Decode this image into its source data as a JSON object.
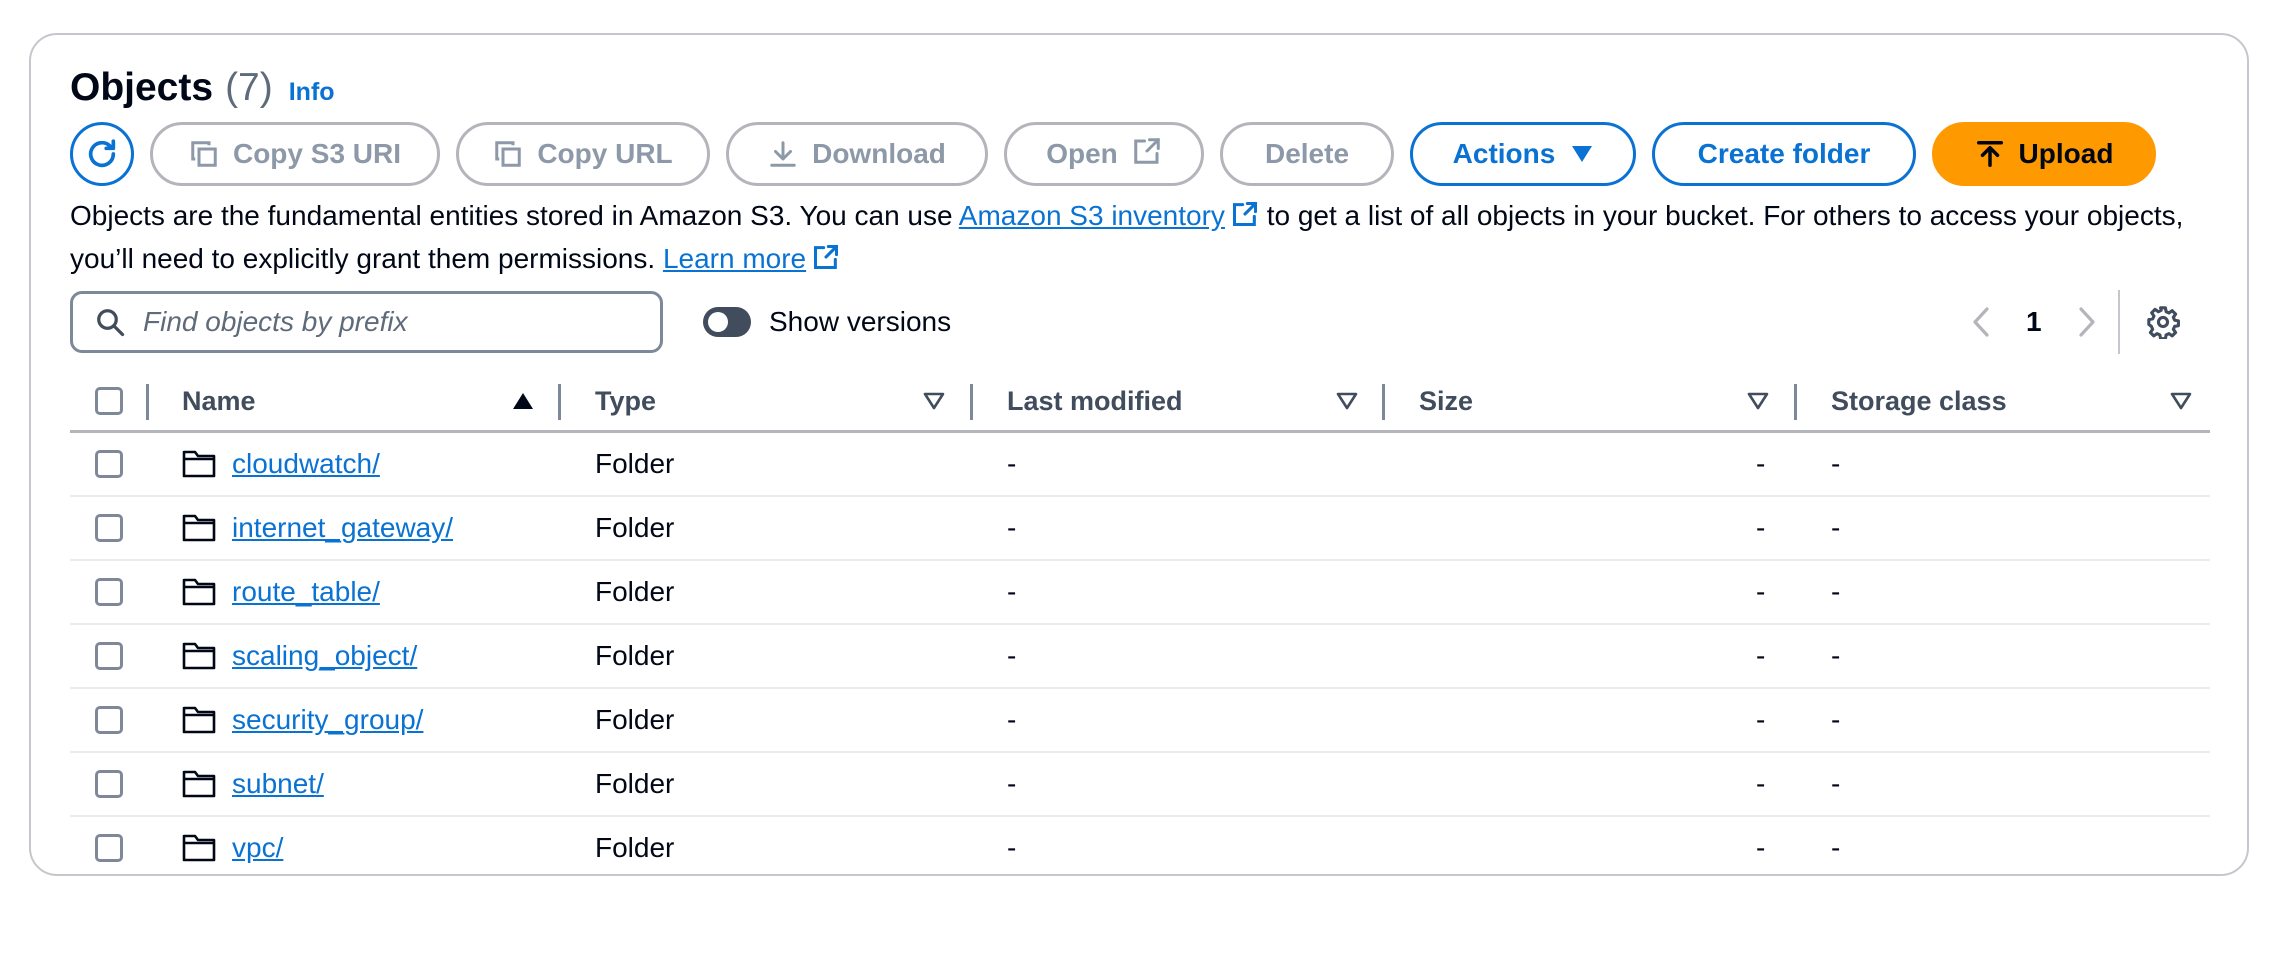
{
  "header": {
    "title": "Objects",
    "count": "(7)",
    "info": "Info"
  },
  "toolbar": {
    "copy_s3_uri": "Copy S3 URI",
    "copy_url": "Copy URL",
    "download": "Download",
    "open": "Open",
    "delete": "Delete",
    "actions": "Actions",
    "create_folder": "Create folder",
    "upload": "Upload"
  },
  "description": {
    "part1": "Objects are the fundamental entities stored in Amazon S3. You can use ",
    "link1": "Amazon S3 inventory",
    "part2": " to get a list of all objects in your bucket. For others to access your objects, you’ll need to explicitly grant them permissions. ",
    "link2": "Learn more"
  },
  "search": {
    "placeholder": "Find objects by prefix"
  },
  "versions": {
    "label": "Show versions"
  },
  "pagination": {
    "page": "1"
  },
  "table": {
    "columns": [
      "Name",
      "Type",
      "Last modified",
      "Size",
      "Storage class"
    ],
    "rows": [
      {
        "name": "cloudwatch/",
        "type": "Folder",
        "last_modified": "-",
        "size": "-",
        "storage_class": "-"
      },
      {
        "name": "internet_gateway/",
        "type": "Folder",
        "last_modified": "-",
        "size": "-",
        "storage_class": "-"
      },
      {
        "name": "route_table/",
        "type": "Folder",
        "last_modified": "-",
        "size": "-",
        "storage_class": "-"
      },
      {
        "name": "scaling_object/",
        "type": "Folder",
        "last_modified": "-",
        "size": "-",
        "storage_class": "-"
      },
      {
        "name": "security_group/",
        "type": "Folder",
        "last_modified": "-",
        "size": "-",
        "storage_class": "-"
      },
      {
        "name": "subnet/",
        "type": "Folder",
        "last_modified": "-",
        "size": "-",
        "storage_class": "-"
      },
      {
        "name": "vpc/",
        "type": "Folder",
        "last_modified": "-",
        "size": "-",
        "storage_class": "-"
      }
    ]
  },
  "colors": {
    "link": "#0972d3",
    "primary": "#ff9900",
    "disabled": "#8d99a8"
  }
}
